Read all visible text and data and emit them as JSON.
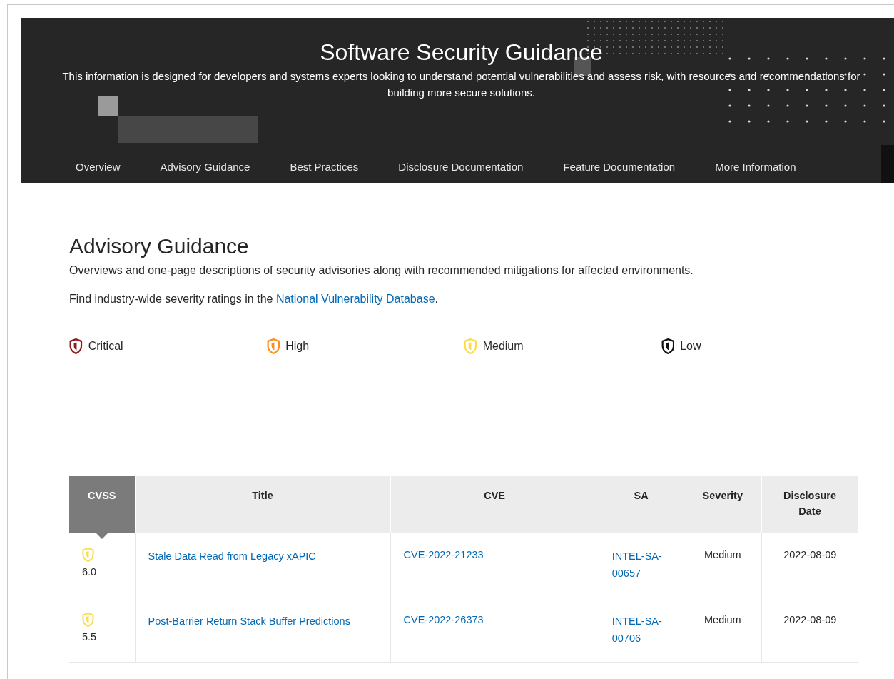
{
  "banner": {
    "title": "Software Security Guidance",
    "description": "This information is designed for developers and systems experts looking to understand potential vulnerabilities and assess risk, with resources and recommendations for building more secure solutions.",
    "nav": [
      {
        "label": "Overview",
        "selected": false
      },
      {
        "label": "Advisory Guidance",
        "selected": false
      },
      {
        "label": "Best Practices",
        "selected": false
      },
      {
        "label": "Disclosure Documentation",
        "selected": false
      },
      {
        "label": "Feature Documentation",
        "selected": false
      },
      {
        "label": "More Information",
        "selected": false
      }
    ]
  },
  "section": {
    "heading": "Advisory Guidance",
    "intro": "Overviews and one-page descriptions of security advisories along with recommended mitigations for affected environments.",
    "find_text": "Find industry-wide severity ratings in the ",
    "find_link": "National Vulnerability Database",
    "find_end": "."
  },
  "legend": [
    {
      "label": "Critical",
      "color": "#8b1a1a"
    },
    {
      "label": "High",
      "color": "#f7901e"
    },
    {
      "label": "Medium",
      "color": "#f9dd4a"
    },
    {
      "label": "Low",
      "color": "#111111"
    }
  ],
  "table": {
    "columns": [
      {
        "label": "CVSS",
        "selected": true
      },
      {
        "label": "Title",
        "selected": false
      },
      {
        "label": "CVE",
        "selected": false
      },
      {
        "label": "SA",
        "selected": false
      },
      {
        "label": "Severity",
        "selected": false
      },
      {
        "label": "Disclosure Date",
        "selected": false
      }
    ],
    "rows": [
      {
        "cvss": "6.0",
        "color": "#f9dd4a",
        "title": "Stale Data Read from Legacy xAPIC",
        "cve": "CVE-2022-21233",
        "sa": "INTEL-SA-00657",
        "severity": "Medium",
        "date": "2022-08-09"
      },
      {
        "cvss": "5.5",
        "color": "#f9dd4a",
        "title": "Post-Barrier Return Stack Buffer Predictions",
        "cve": "CVE-2022-26373",
        "sa": "INTEL-SA-00706",
        "severity": "Medium",
        "date": "2022-08-09"
      }
    ]
  }
}
